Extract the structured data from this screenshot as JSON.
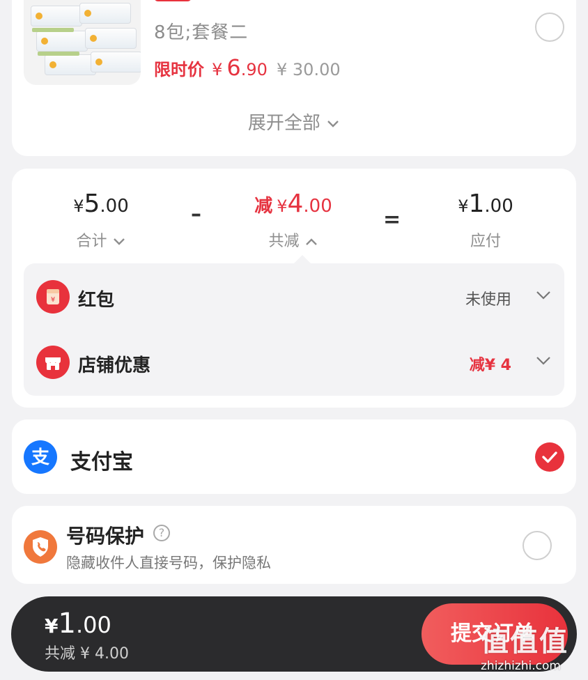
{
  "product": {
    "spec": "8包;套餐二",
    "limit_label": "限时价",
    "price_symbol": "¥",
    "price_int": "6",
    "price_dec": ".90",
    "original_price": "¥ 30.00",
    "expand_label": "展开全部"
  },
  "summary": {
    "total": {
      "symbol": "¥",
      "int": "5",
      "dec": ".00",
      "label": "合计"
    },
    "reduce": {
      "prefix": "减",
      "symbol": "¥",
      "int": "4",
      "dec": ".00",
      "label": "共减"
    },
    "payable": {
      "symbol": "¥",
      "int": "1",
      "dec": ".00",
      "label": "应付"
    },
    "minus_op": "–",
    "equals_op": "=",
    "details": [
      {
        "title": "红包",
        "value": "未使用"
      },
      {
        "title": "店铺优惠",
        "value": "减¥ 4"
      }
    ]
  },
  "payment": {
    "method": "支付宝",
    "selected": true
  },
  "protect": {
    "title": "号码保护",
    "help": "?",
    "desc": "隐藏收件人直接号码，保护隐私"
  },
  "bottom_bar": {
    "symbol": "¥",
    "int": "1",
    "dec": ".00",
    "reduce_text": "共减 ¥ 4.00",
    "submit_label": "提交订单"
  },
  "watermark": {
    "logo": "值值值",
    "site": "zhizhizhi.com"
  },
  "colors": {
    "accent_red": "#e63340",
    "alipay_blue": "#1677ff",
    "protect_orange": "#f0783c",
    "bar_dark": "#2b2b2d"
  }
}
